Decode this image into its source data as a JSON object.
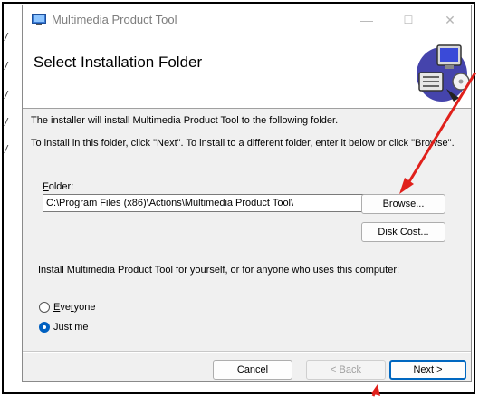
{
  "window": {
    "title": "Multimedia Product Tool",
    "minimize_glyph": "—",
    "maximize_glyph": "☐",
    "close_glyph": "✕"
  },
  "banner": {
    "heading": "Select Installation Folder"
  },
  "body": {
    "intro_line1": "The installer will install Multimedia Product Tool to the following folder.",
    "intro_line2": "To install in this folder, click \"Next\". To install to a different folder, enter it below or click \"Browse\".",
    "folder_label_accel": "F",
    "folder_label_rest": "older:",
    "folder_value": "C:\\Program Files (x86)\\Actions\\Multimedia Product Tool\\",
    "browse_label": "Browse...",
    "disk_cost_label": "Disk Cost...",
    "install_for_text": "Install Multimedia Product Tool for yourself, or for anyone who uses this computer:",
    "options": [
      {
        "label": "Everyone",
        "selected": false
      },
      {
        "label": "Just me",
        "selected": true
      }
    ]
  },
  "footer": {
    "cancel_label": "Cancel",
    "back_label": "< Back",
    "next_label": "Next >"
  },
  "colors": {
    "accent": "#0067c0",
    "annotation_arrow": "#e0201b"
  }
}
